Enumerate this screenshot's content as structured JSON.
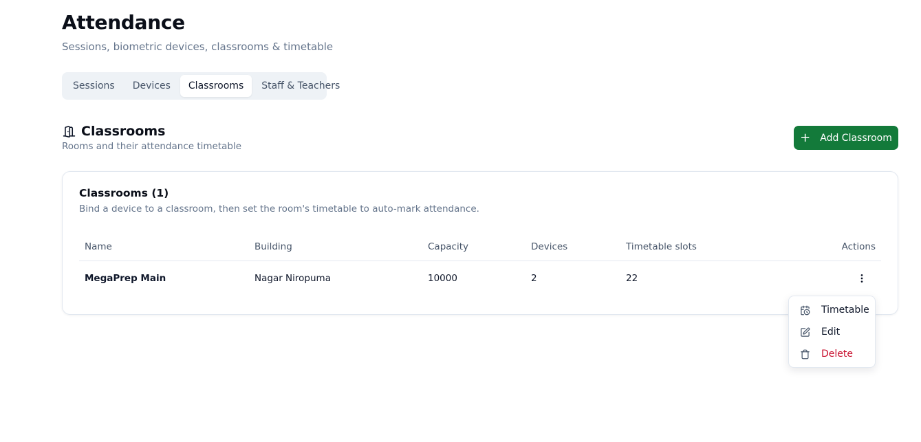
{
  "header": {
    "title": "Attendance",
    "subtitle": "Sessions, biometric devices, classrooms & timetable"
  },
  "tabs": [
    {
      "label": "Sessions",
      "active": false
    },
    {
      "label": "Devices",
      "active": false
    },
    {
      "label": "Classrooms",
      "active": true
    },
    {
      "label": "Staff & Teachers",
      "active": false
    }
  ],
  "section": {
    "icon": "door-icon",
    "title": "Classrooms",
    "subtitle": "Rooms and their attendance timetable",
    "add_button_label": "Add Classroom"
  },
  "card": {
    "title": "Classrooms (1)",
    "description": "Bind a device to a classroom, then set the room's timetable to auto-mark attendance.",
    "columns": [
      "Name",
      "Building",
      "Capacity",
      "Devices",
      "Timetable slots",
      "Actions"
    ],
    "rows": [
      {
        "name": "MegaPrep Main",
        "building": "Nagar Niropuma",
        "capacity": "10000",
        "devices": "2",
        "timetable_slots": "22"
      }
    ]
  },
  "row_menu": {
    "items": [
      {
        "label": "Timetable",
        "icon": "calendar-clock-icon",
        "danger": false
      },
      {
        "label": "Edit",
        "icon": "edit-icon",
        "danger": false
      },
      {
        "label": "Delete",
        "icon": "trash-icon",
        "danger": true
      }
    ]
  },
  "colors": {
    "primary": "#137a3a",
    "danger": "#c8102e",
    "muted_text": "#64748b",
    "tab_bg": "#eef2f6"
  }
}
